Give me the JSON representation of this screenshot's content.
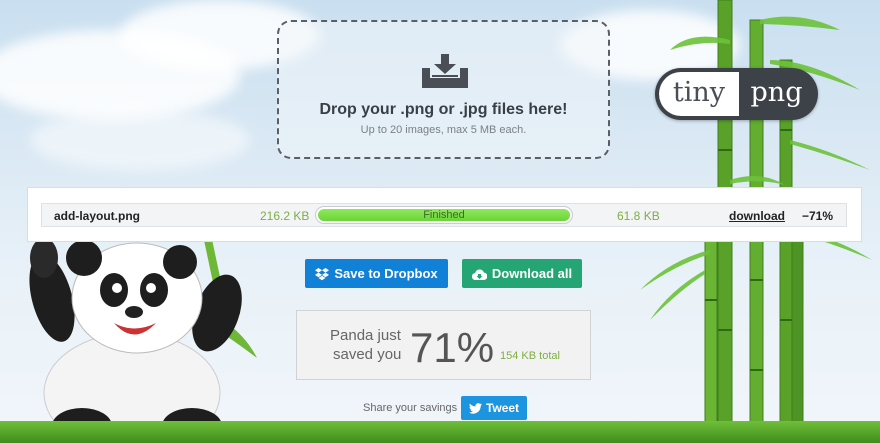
{
  "dropzone": {
    "title": "Drop your .png or .jpg files here!",
    "subtitle": "Up to 20 images, max 5 MB each.",
    "icon": "upload-tray-icon"
  },
  "logo": {
    "left": "tiny",
    "right": "png"
  },
  "results": [
    {
      "filename": "add-layout.png",
      "original_size": "216.2 KB",
      "status": "Finished",
      "progress": 1.0,
      "new_size": "61.8 KB",
      "download_label": "download",
      "saving": "−71%"
    }
  ],
  "actions": {
    "dropbox_label": "Save to Dropbox",
    "dropbox_icon": "dropbox-icon",
    "download_all_label": "Download all",
    "download_all_icon": "cloud-download-icon"
  },
  "savings": {
    "line1": "Panda just",
    "line2": "saved you",
    "percent": "71%",
    "total": "154 KB total"
  },
  "share": {
    "label": "Share your savings",
    "tweet_label": "Tweet",
    "tweet_icon": "twitter-bird-icon"
  },
  "colors": {
    "dropbox": "#1180d7",
    "download_all": "#26a574",
    "tweet": "#1c94e0",
    "progress_fill": "#78dc45",
    "size_text": "#7eae45"
  }
}
